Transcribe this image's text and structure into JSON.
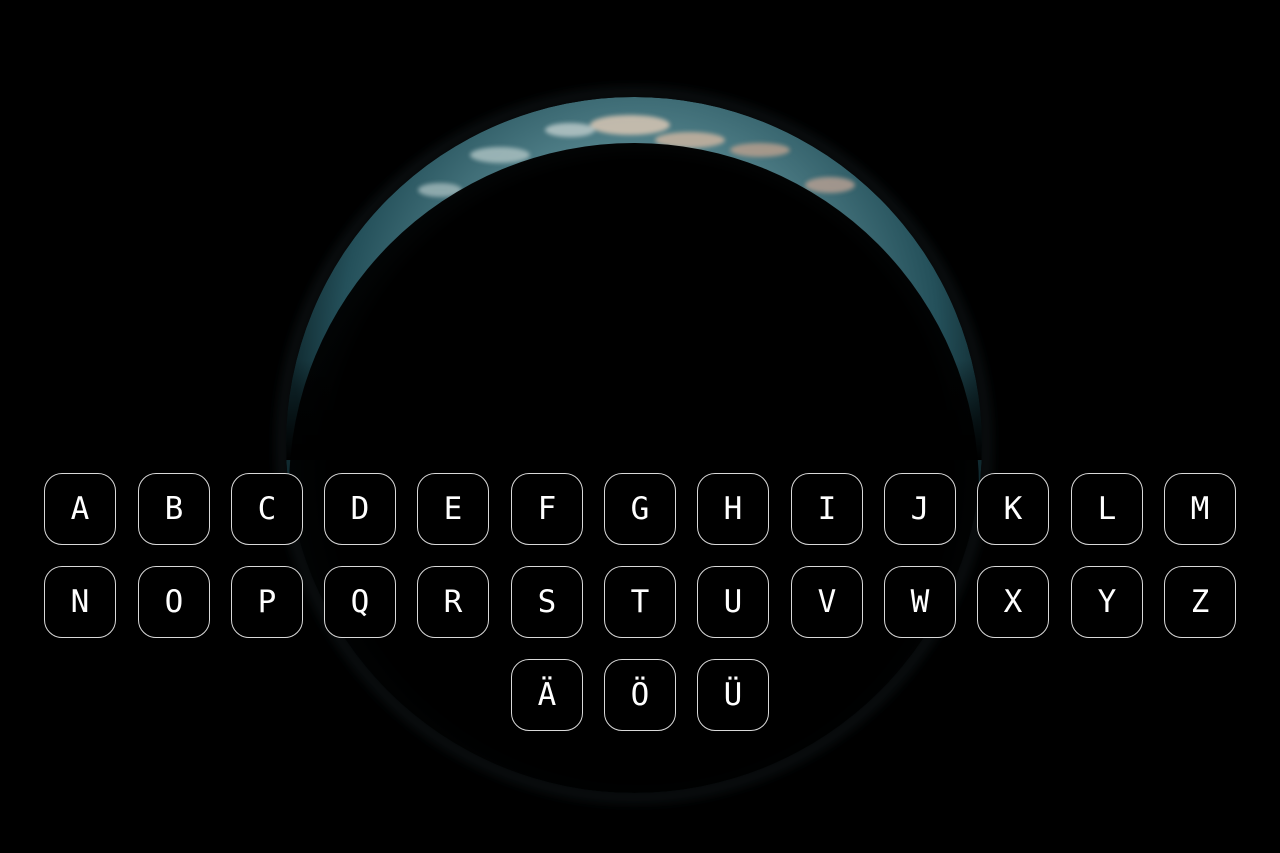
{
  "scene": {
    "background_color": "#000000",
    "planet_icon": "earth-crescent",
    "planet_colors": {
      "ocean_light": "#7fa3a6",
      "ocean_mid": "#3c6870",
      "ocean_dark": "#16323a",
      "land": "#c8b8a8"
    }
  },
  "keyboard": {
    "key_border_color": "#d9d9d9",
    "key_text_color": "#ffffff",
    "rows": [
      [
        "A",
        "B",
        "C",
        "D",
        "E",
        "F",
        "G",
        "H",
        "I",
        "J",
        "K",
        "L",
        "M"
      ],
      [
        "N",
        "O",
        "P",
        "Q",
        "R",
        "S",
        "T",
        "U",
        "V",
        "W",
        "X",
        "Y",
        "Z"
      ],
      [
        "Ä",
        "Ö",
        "Ü"
      ]
    ]
  }
}
